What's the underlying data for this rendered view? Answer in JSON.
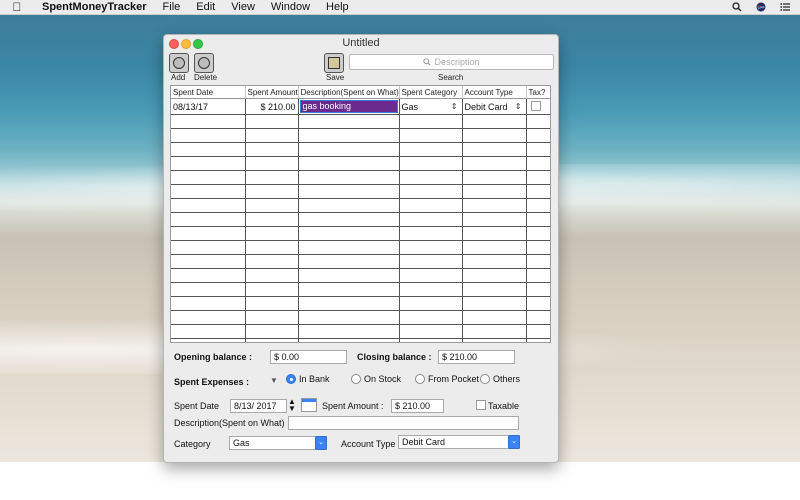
{
  "menubar": {
    "app_name": "SpentMoneyTracker",
    "menus": [
      "File",
      "Edit",
      "View",
      "Window",
      "Help"
    ]
  },
  "window": {
    "title": "Untitled",
    "toolbar": {
      "add_label": "Add",
      "delete_label": "Delete",
      "save_label": "Save",
      "search_label": "Search",
      "search_placeholder": "Description"
    }
  },
  "table": {
    "columns": [
      "Spent Date",
      "Spent Amount",
      "Description(Spent on What)",
      "Spent Category",
      "Account Type",
      "Tax?"
    ],
    "rows": [
      {
        "date": "08/13/17",
        "amount": "$ 210.00",
        "description": "gas booking",
        "category": "Gas",
        "account": "Debit Card",
        "tax": false
      }
    ],
    "empty_rows": 17
  },
  "form": {
    "opening_balance_label": "Opening balance :",
    "opening_balance_value": "$ 0.00",
    "closing_balance_label": "Closing balance :",
    "closing_balance_value": "$ 210.00",
    "spent_expenses_label": "Spent Expenses :",
    "expense_options": [
      "In Bank",
      "On Stock",
      "From Pocket",
      "Others"
    ],
    "expense_selected": "In Bank",
    "spent_date_label": "Spent Date",
    "spent_date_value": "8/13/ 2017",
    "spent_amount_label": "Spent Amount :",
    "spent_amount_value": "$ 210.00",
    "taxable_label": "Taxable",
    "taxable_checked": false,
    "description_label": "Description(Spent on What)",
    "description_value": "",
    "category_label": "Category",
    "category_value": "Gas",
    "account_type_label": "Account Type",
    "account_type_value": "Debit Card"
  },
  "colors": {
    "selection": "#6b2a8e",
    "accent": "#3b82f6"
  }
}
